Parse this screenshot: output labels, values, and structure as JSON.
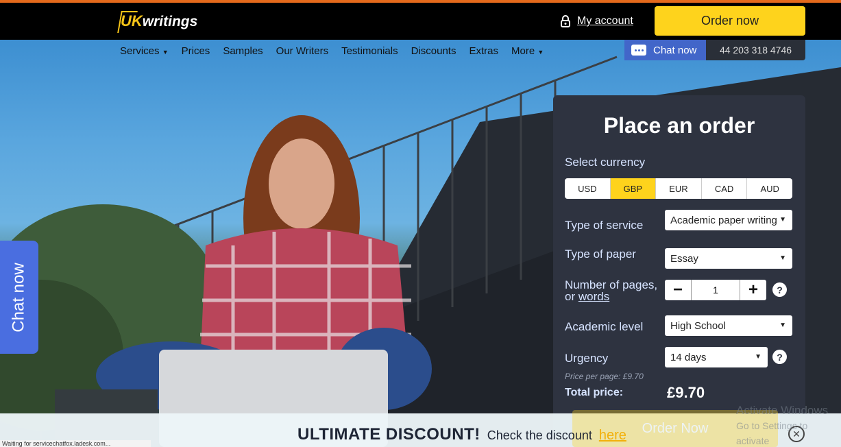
{
  "header": {
    "logo_uk": "UK",
    "logo_rest": "writings",
    "my_account": "My account",
    "order_now": "Order now"
  },
  "nav": {
    "items": [
      "Services",
      "Prices",
      "Samples",
      "Our Writers",
      "Testimonials",
      "Discounts",
      "Extras",
      "More"
    ],
    "chat_now": "Chat now",
    "phone": "44 203 318 4746"
  },
  "side_chat": "Chat now",
  "order_panel": {
    "title": "Place an order",
    "currency_label": "Select currency",
    "currencies": [
      "USD",
      "GBP",
      "EUR",
      "CAD",
      "AUD"
    ],
    "selected_currency": "GBP",
    "service_label": "Type of service",
    "service_value": "Academic paper writing",
    "paper_label": "Type of paper",
    "paper_value": "Essay",
    "pages_label_1": "Number of pages,",
    "pages_label_2": "or",
    "pages_label_link": "words",
    "pages_value": "1",
    "level_label": "Academic level",
    "level_value": "High School",
    "urgency_label": "Urgency",
    "urgency_value": "14 days",
    "price_per_page": "Price per page:  £9.70",
    "total_label": "Total price:",
    "total_value": "£9.70",
    "order_button": "Order Now"
  },
  "banner": {
    "headline": "ULTIMATE DISCOUNT!",
    "text": "Check the discount",
    "link": "here"
  },
  "status_bar": "Waiting for servicechatfox.ladesk.com...",
  "watermark": {
    "line1": "Activate Windows",
    "line2": "Go to Settings to activate"
  },
  "colors": {
    "accent_yellow": "#fed31c",
    "chat_blue": "#4266c9",
    "panel_bg": "#2e3340",
    "top_line": "#e46a1c"
  }
}
